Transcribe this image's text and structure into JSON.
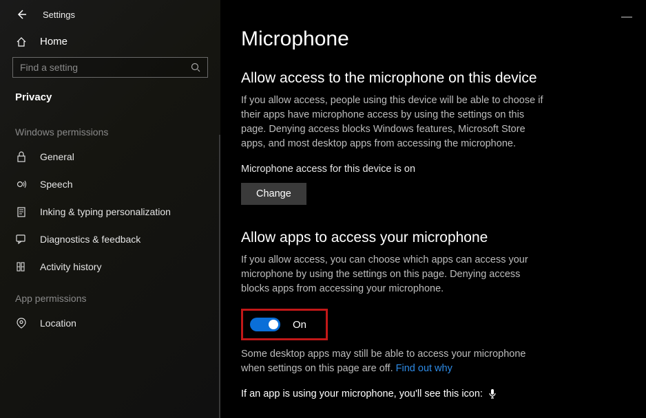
{
  "titlebar": {
    "title": "Settings"
  },
  "sidebar": {
    "home": "Home",
    "search_placeholder": "Find a setting",
    "category": "Privacy",
    "section_windows": "Windows permissions",
    "section_app": "App permissions",
    "items_windows": [
      {
        "label": "General"
      },
      {
        "label": "Speech"
      },
      {
        "label": "Inking & typing personalization"
      },
      {
        "label": "Diagnostics & feedback"
      },
      {
        "label": "Activity history"
      }
    ],
    "items_app": [
      {
        "label": "Location"
      }
    ]
  },
  "content": {
    "page_title": "Microphone",
    "sec1_heading": "Allow access to the microphone on this device",
    "sec1_desc": "If you allow access, people using this device will be able to choose if their apps have microphone access by using the settings on this page. Denying access blocks Windows features, Microsoft Store apps, and most desktop apps from accessing the microphone.",
    "sec1_status": "Microphone access for this device is on",
    "change_btn": "Change",
    "sec2_heading": "Allow apps to access your microphone",
    "sec2_desc": "If you allow access, you can choose which apps can access your microphone by using the settings on this page. Denying access blocks apps from accessing your microphone.",
    "toggle_label": "On",
    "note_prefix": "Some desktop apps may still be able to access your microphone when settings on this page are off. ",
    "note_link": "Find out why",
    "mic_line": "If an app is using your microphone, you'll see this icon:"
  }
}
